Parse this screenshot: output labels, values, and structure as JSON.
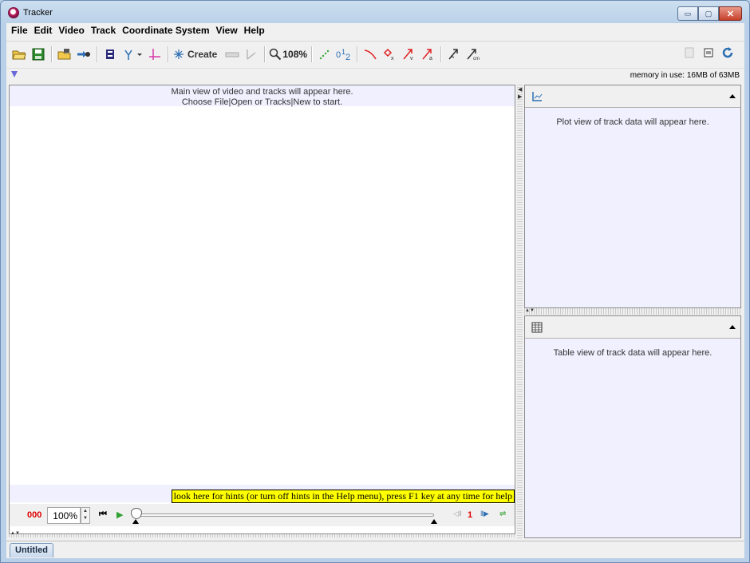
{
  "window": {
    "title": "Tracker",
    "controls": {
      "minimize": "▭",
      "maximize": "▢",
      "close": "✕"
    }
  },
  "menubar": {
    "items": [
      "File",
      "Edit",
      "Video",
      "Track",
      "Coordinate System",
      "View",
      "Help"
    ]
  },
  "toolbar": {
    "create_label": "Create",
    "zoom_label": "108%",
    "icons": [
      "open-folder-icon",
      "save-icon",
      "open-video-icon",
      "import-icon",
      "clip-settings-icon",
      "calibration-icon",
      "axes-icon",
      "create-track-icon",
      "tape-icon",
      "protractor-icon",
      "zoom-icon",
      "trails-icon",
      "labels-icon",
      "position-icon",
      "x-icon",
      "velocity-icon",
      "acceleration-icon",
      "mass-icon",
      "center-of-mass-icon",
      "notes-icon",
      "refresh-icon"
    ]
  },
  "infostrip": {
    "memory": "memory in use: 16MB of 63MB"
  },
  "mainview": {
    "message_line1": "Main view of video and tracks will appear here.",
    "message_line2": "Choose File|Open or Tracks|New to start.",
    "hint": "look here for hints (or turn off hints in the Help menu), press F1 key at any time for help"
  },
  "player": {
    "frame_number": "000",
    "rate": "100%",
    "step_size": "1",
    "progress": 0
  },
  "plot_panel": {
    "message": "Plot view of track data will appear here."
  },
  "table_panel": {
    "message": "Table view of track data will appear here."
  },
  "tabs": [
    {
      "label": "Untitled",
      "selected": true
    }
  ],
  "colors": {
    "accent_red": "#e00000",
    "hint_background": "#ffff00",
    "panel_background": "#f0f0ff",
    "triangle_blue": "#6868d8"
  }
}
